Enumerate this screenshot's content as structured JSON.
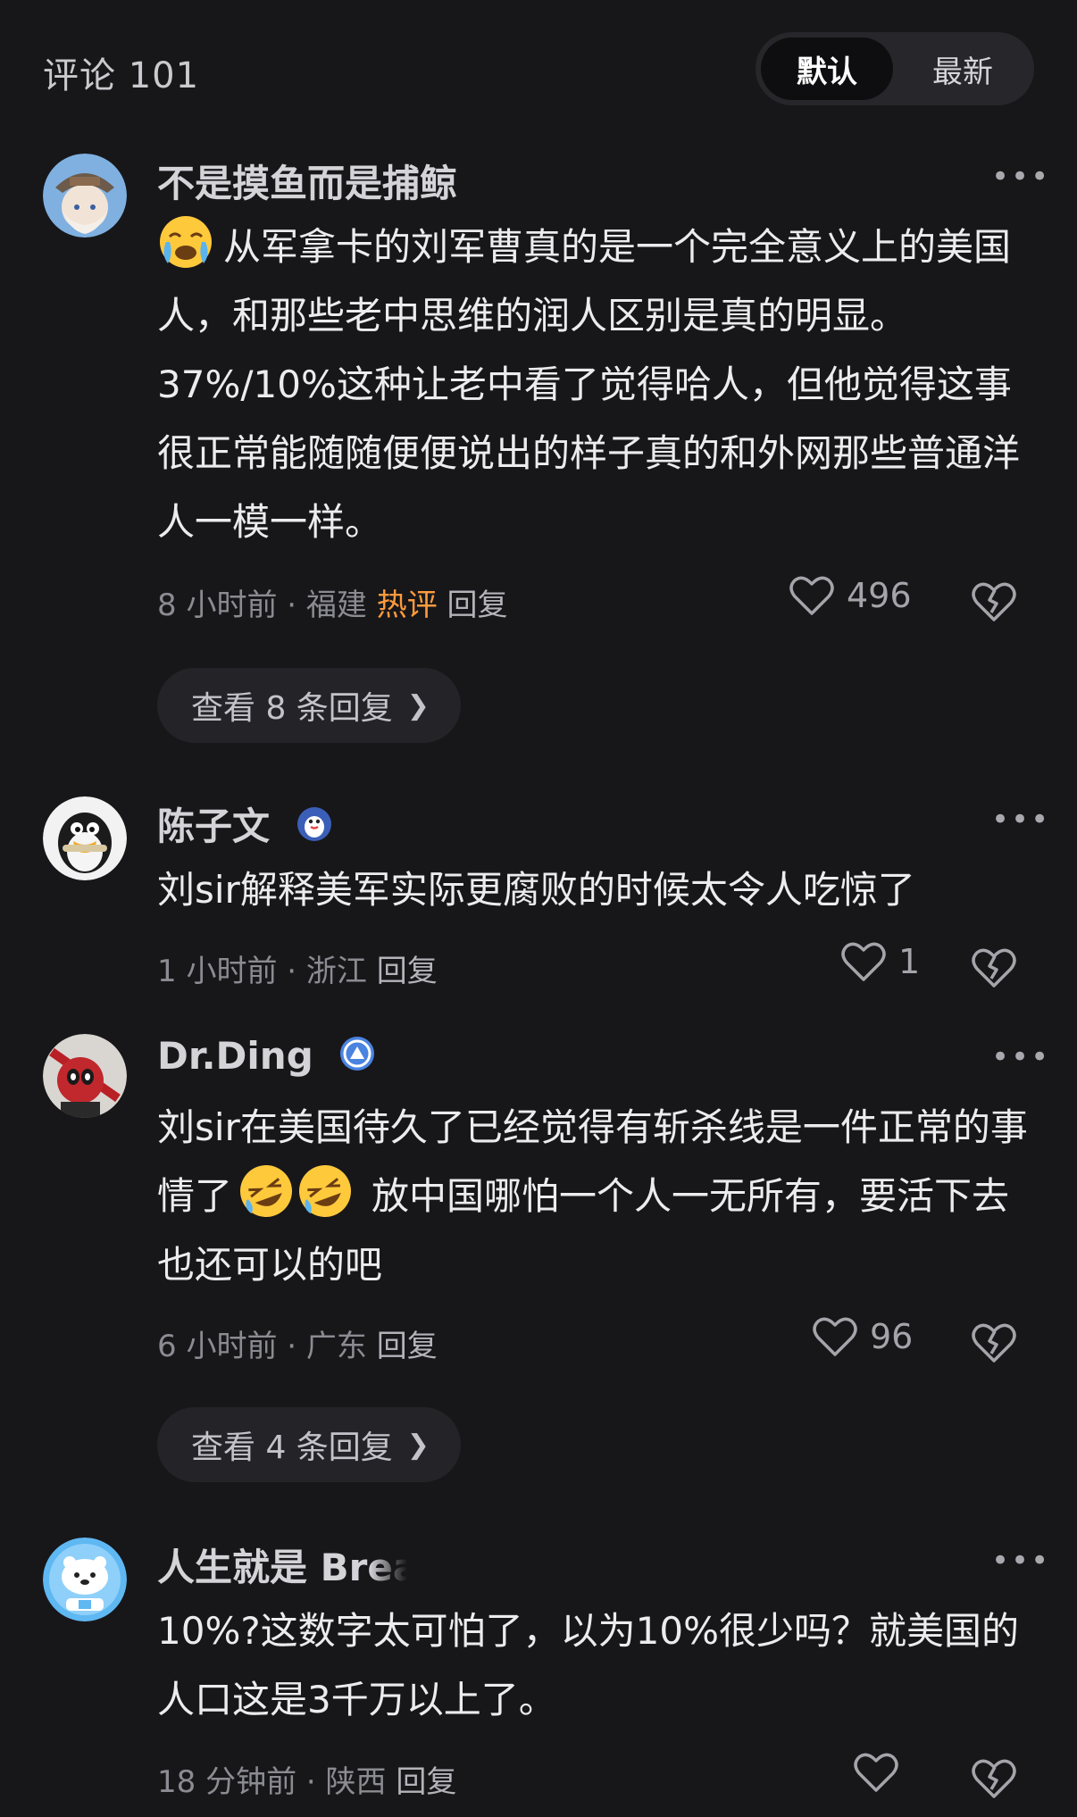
{
  "header": {
    "title": "评论 101",
    "sort_default": "默认",
    "sort_latest": "最新"
  },
  "comments": [
    {
      "username": "不是摸鱼而是捕鲸",
      "text": "从军拿卡的刘军曹真的是一个完全意义上的美国人，和那些老中思维的润人区别是真的明显。37%/10%这种让老中看了觉得哈人，但他觉得这事很正常能随随便便说出的样子真的和外网那些普通洋人一模一样。",
      "time": "8 小时前",
      "location": "福建",
      "hot_label": "热评",
      "reply_label": "回复",
      "likes": "496",
      "view_replies": "查看 8 条回复"
    },
    {
      "username": "陈子文",
      "text": "刘sir解释美军实际更腐败的时候太令人吃惊了",
      "time": "1 小时前",
      "location": "浙江",
      "reply_label": "回复",
      "likes": "1"
    },
    {
      "username": "Dr.Ding",
      "text_part1": "刘sir在美国待久了已经觉得有斩杀线是一件正常的事情了",
      "text_part2": "放中国哪怕一个人一无所有，要活下去也还可以的吧",
      "time": "6 小时前",
      "location": "广东",
      "reply_label": "回复",
      "likes": "96",
      "view_replies": "查看 4 条回复"
    },
    {
      "username": "人生就是 Brea",
      "text": "10%?这数字太可怕了，以为10%很少吗？就美国的人口这是3千万以上了。",
      "time": "18 分钟前",
      "location": "陕西",
      "reply_label": "回复"
    }
  ],
  "colors": {
    "background": "#17171a",
    "hot": "#ff9b3d",
    "pill": "#242428"
  },
  "icons": [
    "heart-icon",
    "broken-heart-icon",
    "more-icon",
    "chevron-right-icon"
  ]
}
